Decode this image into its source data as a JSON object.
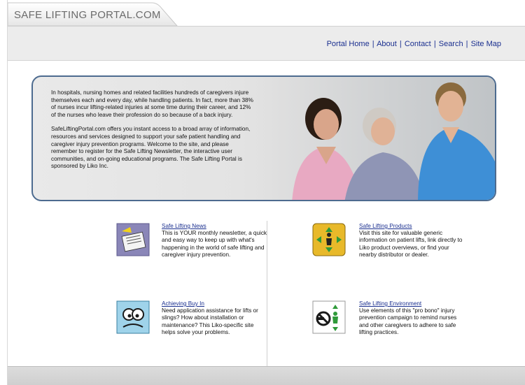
{
  "site": {
    "logo_text": "SAFE LIFTING PORTAL.COM"
  },
  "nav": {
    "links": [
      "Portal Home",
      "About",
      "Contact",
      "Search",
      "Site Map"
    ],
    "separator": "|"
  },
  "hero": {
    "paragraphs": [
      "In hospitals, nursing homes and related facilities hundreds of caregivers injure themselves each and every day, while handling patients. In fact, more than 38% of nurses incur lifting-related injuries at some time during their career, and 12% of the nurses who leave their profession do so because of a back injury.",
      "SafeLiftingPortal.com offers you instant access to a broad array of information, resources and services designed to support your safe patient handling and caregiver injury prevention programs. Welcome to the site, and please remember to register for the Safe Lifting Newsletter, the interactive user communities, and on-going educational programs. The Safe Lifting Portal is sponsored by Liko Inc."
    ]
  },
  "features": [
    {
      "title": "Safe Lifting News",
      "description": "This is YOUR monthly newsletter, a quick and easy way to keep up with what's happening in the world of safe lifting and caregiver injury prevention.",
      "icon": "newspaper-icon"
    },
    {
      "title": "Safe Lifting Products",
      "description": "Visit this site for valuable generic information on patient lifts, link directly to Liko product overviews, or find your nearby distributor or dealer.",
      "icon": "lift-arrows-icon"
    },
    {
      "title": "Achieving Buy In",
      "description": "Need application assistance for lifts or slings? How about installation or maintenance? This Liko-specific site helps solve your problems.",
      "icon": "face-icon"
    },
    {
      "title": "Safe Lifting Environment",
      "description": "Use elements of this \"pro bono\" injury prevention campaign to remind nurses and other caregivers to adhere to safe lifting practices.",
      "icon": "no-lift-sign-icon"
    }
  ],
  "colors": {
    "link": "#1a2f8f",
    "hero_border": "#4d6b8f",
    "nav_bg": "#ececec"
  }
}
